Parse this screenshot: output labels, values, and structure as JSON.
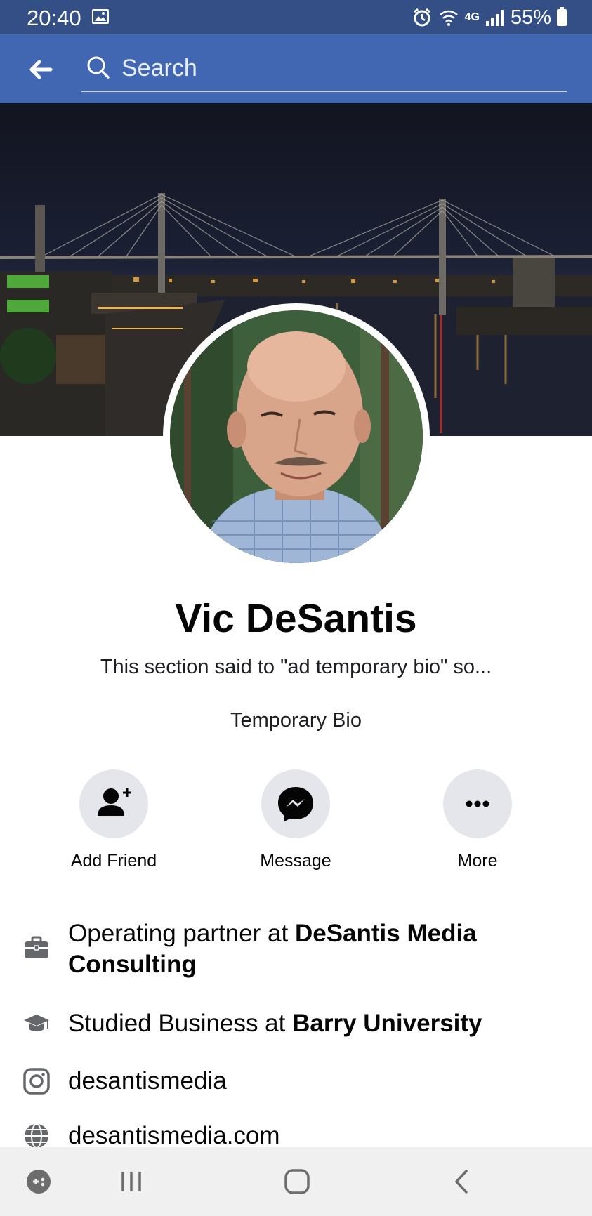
{
  "status_bar": {
    "time": "20:40",
    "network": "4G",
    "battery": "55%",
    "icons": [
      "gallery-icon",
      "alarm-icon",
      "wifi-icon",
      "signal-icon",
      "battery-icon"
    ]
  },
  "header": {
    "back_icon": "arrow-left-icon",
    "search_placeholder": "Search",
    "colors": {
      "status_bar": "#344e86",
      "header": "#4267b2"
    }
  },
  "profile": {
    "name": "Vic DeSantis",
    "bio": "This section said to \"ad temporary bio\" so...",
    "bio_subtitle": "Temporary Bio"
  },
  "actions": [
    {
      "label": "Add Friend",
      "icon": "add-friend-icon"
    },
    {
      "label": "Message",
      "icon": "messenger-icon"
    },
    {
      "label": "More",
      "icon": "more-icon"
    }
  ],
  "intro": {
    "work": {
      "prefix": "Operating partner at ",
      "org": "DeSantis Media Consulting",
      "icon": "briefcase-icon"
    },
    "education": {
      "prefix": "Studied Business at ",
      "org": "Barry University",
      "icon": "graduation-cap-icon"
    },
    "instagram": {
      "text": "desantismedia",
      "icon": "instagram-icon"
    },
    "website": {
      "text": "desantismedia.com",
      "icon": "globe-icon"
    }
  },
  "nav_bar": {
    "buttons": [
      "game-launcher-icon",
      "recent-apps-icon",
      "home-icon",
      "back-icon"
    ]
  }
}
